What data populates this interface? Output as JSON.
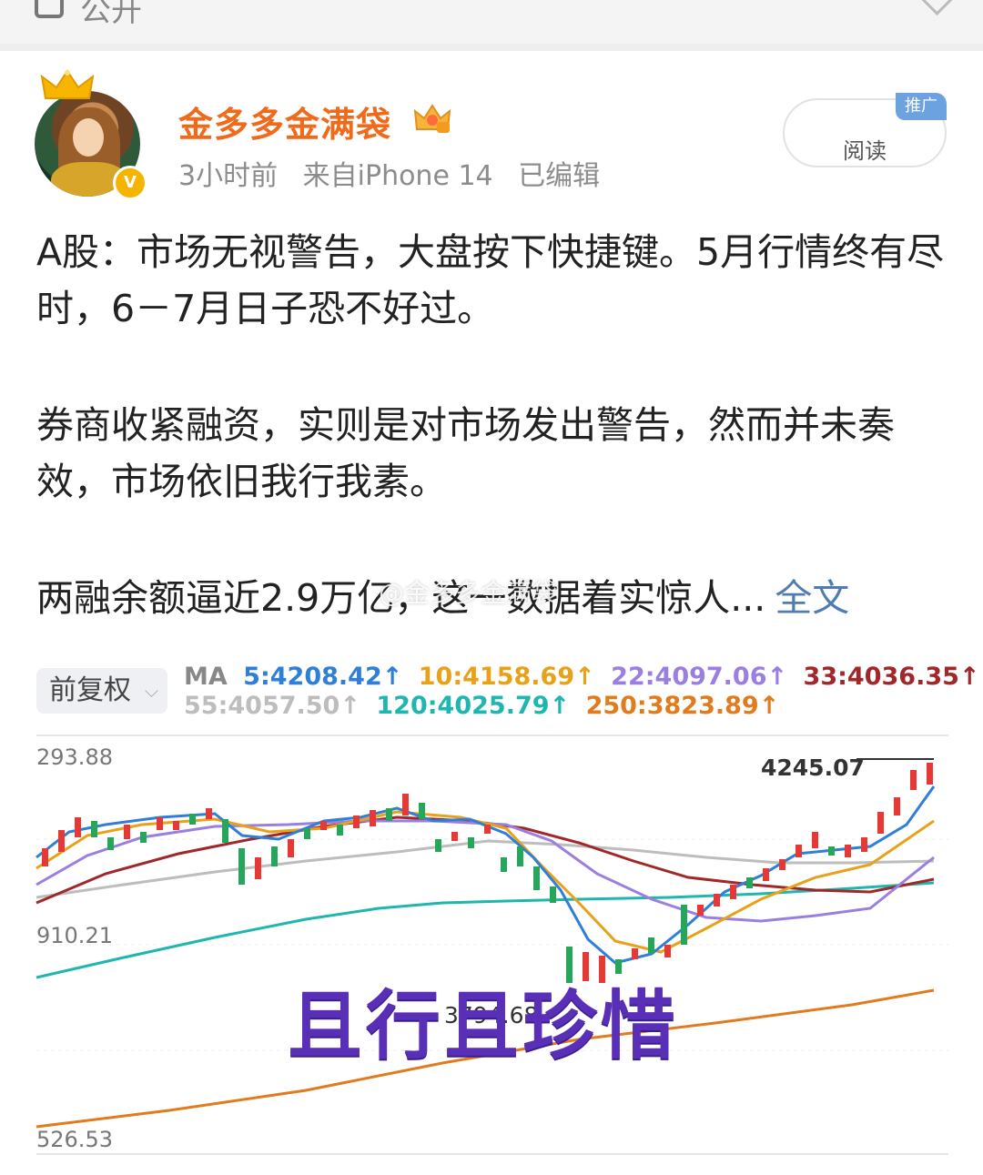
{
  "topbar": {
    "public_label": "公开"
  },
  "post": {
    "username": "金多多金满袋",
    "meta": {
      "time": "3小时前",
      "source": "来自iPhone 14",
      "edited": "已编辑"
    },
    "follow_button": {
      "label": "阅读",
      "ad_tag": "推广"
    },
    "paragraph1": "A股：市场无视警告，大盘按下快捷键。5月行情终有尽时，6－7月日子恐不好过。",
    "paragraph2": "券商收紧融资，实则是对市场发出警告，然而并未奏效，市场依旧我行我素。",
    "paragraph3": "两融余额逼近2.9万亿，这一数据着实惊人...",
    "read_more": "全文",
    "watermark": "@金多多金满袋"
  },
  "chart": {
    "adj_label": "前复权",
    "ma_prefix": "MA",
    "ma_values": [
      {
        "label": "5:4208.42↑",
        "color": "#2f7fd8"
      },
      {
        "label": "10:4158.69↑",
        "color": "#e8a21a"
      },
      {
        "label": "22:4097.06↑",
        "color": "#9b7fe0"
      },
      {
        "label": "33:4036.35↑",
        "color": "#a0282a"
      },
      {
        "label": "55:4057.50↑",
        "color": "#bdbdbd"
      },
      {
        "label": "120:4025.79↑",
        "color": "#1fb6b0"
      },
      {
        "label": "250:3823.89↑",
        "color": "#e07b1e"
      }
    ],
    "overlay_title": "且行且珍惜",
    "price_labels": {
      "top": "293.88",
      "mid": "910.21",
      "low": "3794.68",
      "bottom": "526.53",
      "high_mark": "4245.07"
    }
  },
  "chart_data": {
    "type": "candlestick",
    "y_ticks": [
      "293.88",
      "910.21",
      "526.53"
    ],
    "annotations": [
      "4245.07",
      "3794.68"
    ],
    "series": [
      {
        "name": "MA5",
        "last": 4208.42
      },
      {
        "name": "MA10",
        "last": 4158.69
      },
      {
        "name": "MA22",
        "last": 4097.06
      },
      {
        "name": "MA33",
        "last": 4036.35
      },
      {
        "name": "MA55",
        "last": 4057.5
      },
      {
        "name": "MA120",
        "last": 4025.79
      },
      {
        "name": "MA250",
        "last": 3823.89
      }
    ]
  }
}
